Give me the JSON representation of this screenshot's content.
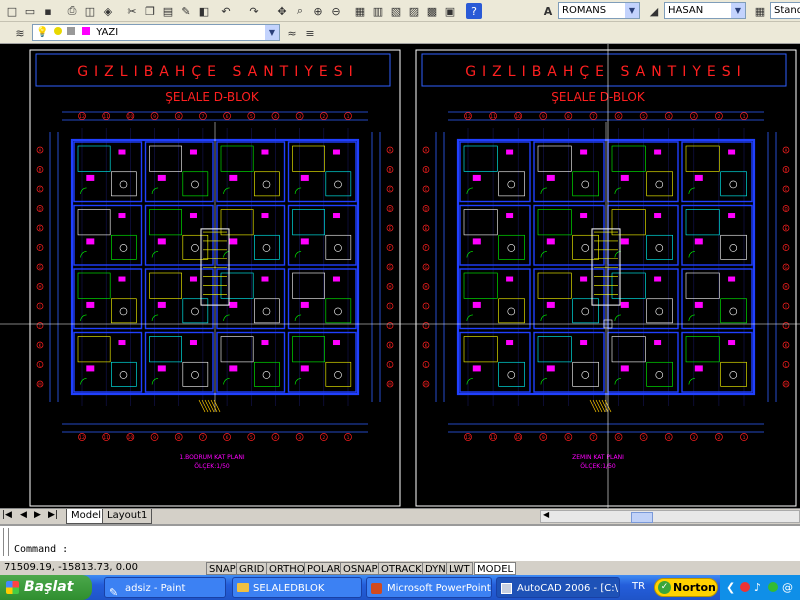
{
  "toolbar1": {
    "text_style": "ROMANS",
    "dim_style": "HASAN",
    "table_style": "Stand"
  },
  "toolbar2": {
    "layer": "YAZI"
  },
  "drawing": {
    "project_title": "GIZLIBAHÇE SANTIYESI",
    "block_title": "ŞELALE D-BLOK",
    "left_plan_name": "1.BODRUM KAT PLANI",
    "left_scale": "ÖLÇEK:1/50",
    "right_plan_name": "ZEMIN KAT PLANI",
    "right_scale": "ÖLÇEK:1/50",
    "grid_top": [
      "12",
      "11",
      "10",
      "9",
      "8",
      "7",
      "6",
      "5",
      "4",
      "3",
      "2",
      "1"
    ],
    "grid_side": [
      "A",
      "B",
      "C",
      "D",
      "E",
      "F",
      "G",
      "H",
      "I",
      "J",
      "K",
      "L",
      "M"
    ]
  },
  "tabs": {
    "model": "Model",
    "layout1": "Layout1"
  },
  "command": {
    "prompt": "Command :"
  },
  "status": {
    "coords": "71509.19, -15813.73, 0.00",
    "buttons": [
      "SNAP",
      "GRID",
      "ORTHO",
      "POLAR",
      "OSNAP",
      "OTRACK",
      "DYN",
      "LWT",
      "MODEL"
    ]
  },
  "taskbar": {
    "start": "Başlat",
    "tasks": [
      "adsiz - Paint",
      "SELALEDBLOK",
      "Microsoft PowerPoint...",
      "AutoCAD 2006 - [C:\\..."
    ],
    "lang": "TR",
    "norton": "Norton"
  }
}
